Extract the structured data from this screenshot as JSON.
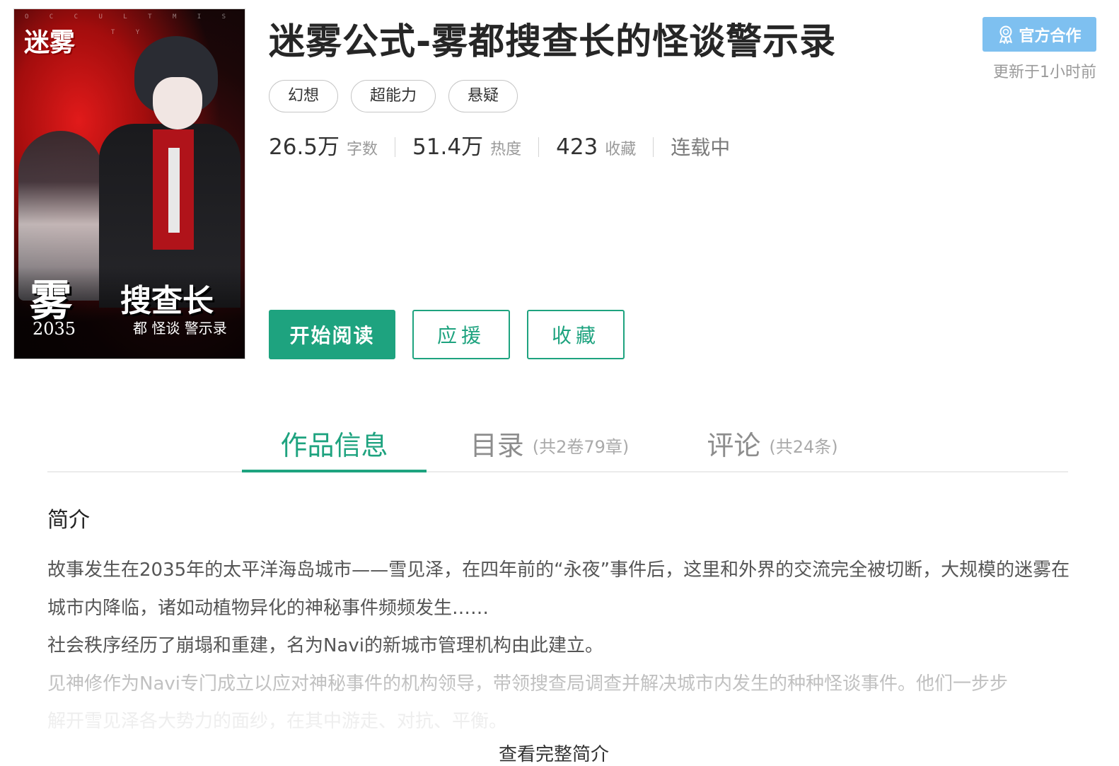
{
  "cover": {
    "ribbon_text": "O C C U L T   M I S T Y",
    "logo_text": "迷雾",
    "art_title_line1": "雾",
    "art_title_line2": "搜查长",
    "art_year": "2035",
    "art_sub": "都 怪谈 警示录"
  },
  "book": {
    "title": "迷雾公式-雾都搜查长的怪谈警示录",
    "tags": [
      "幻想",
      "超能力",
      "悬疑"
    ],
    "stats": {
      "words": {
        "value": "26.5万",
        "label": "字数"
      },
      "heat": {
        "value": "51.4万",
        "label": "热度"
      },
      "favorites": {
        "value": "423",
        "label": "收藏"
      },
      "status": "连载中"
    }
  },
  "badge": {
    "label": "官方合作",
    "icon": "award-ribbon-icon",
    "color": "#7ec0f0"
  },
  "updated_text": "更新于1小时前",
  "actions": {
    "read_label": "开始阅读",
    "support_label": "应援",
    "favorite_label": "收藏",
    "accent_color": "#1ea37f"
  },
  "tabs": [
    {
      "label": "作品信息",
      "sub": "",
      "active": true
    },
    {
      "label": "目录",
      "sub": "(共2卷79章)",
      "active": false
    },
    {
      "label": "评论",
      "sub": "(共24条)",
      "active": false
    }
  ],
  "synopsis": {
    "heading": "简介",
    "paragraphs": [
      "故事发生在2035年的太平洋海岛城市——雪见泽，在四年前的“永夜”事件后，这里和外界的交流完全被切断，大规模的迷雾在城市内降临，诸如动植物异化的神秘事件频频发生……",
      "社会秩序经历了崩塌和重建，名为Navi的新城市管理机构由此建立。",
      "见神修作为Navi专门成立以应对神秘事件的机构领导，带领搜查局调查并解决城市内发生的种种怪谈事件。他们一步步",
      "解开雪见泽各大势力的面纱，在其中游走、对抗、平衡。"
    ],
    "expand_label": "查看完整简介"
  }
}
